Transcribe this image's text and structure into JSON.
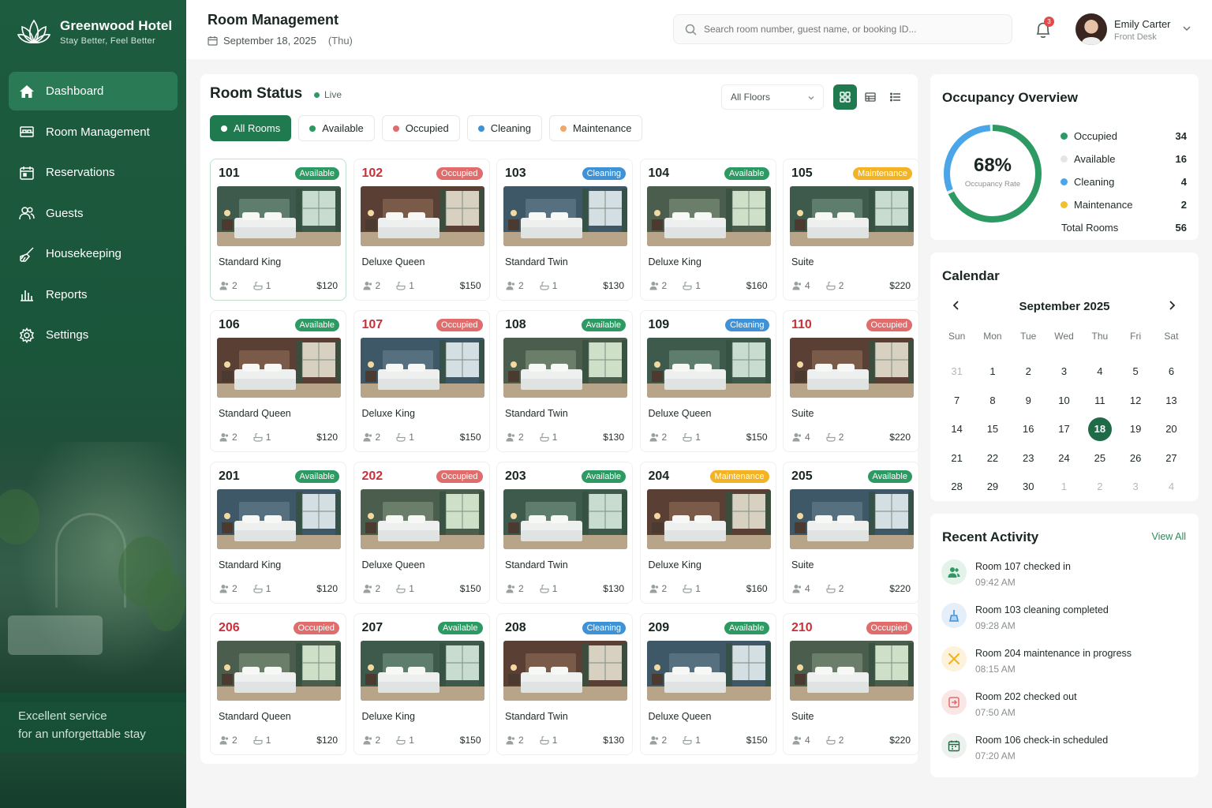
{
  "brand": {
    "name": "Greenwood Hotel",
    "tagline": "Stay Better, Feel Better"
  },
  "sidebar": {
    "items": [
      {
        "label": "Dashboard",
        "icon": "home-icon",
        "active": true
      },
      {
        "label": "Room Management",
        "icon": "bed-icon"
      },
      {
        "label": "Reservations",
        "icon": "calendar-icon"
      },
      {
        "label": "Guests",
        "icon": "users-icon"
      },
      {
        "label": "Housekeeping",
        "icon": "broom-icon"
      },
      {
        "label": "Reports",
        "icon": "bar-chart-icon"
      },
      {
        "label": "Settings",
        "icon": "gear-icon"
      }
    ],
    "footer_line1": "Excellent service",
    "footer_line2": "for an unforgettable stay"
  },
  "header": {
    "title": "Room Management",
    "date": "September 18, 2025",
    "weekday": "(Thu)",
    "search_placeholder": "Search room number, guest name, or booking ID...",
    "notification_count": "3",
    "user_name": "Emily Carter",
    "user_role": "Front Desk"
  },
  "room_status": {
    "title": "Room Status",
    "live_label": "Live",
    "floor_select": "All Floors",
    "filters": [
      {
        "label": "All Rooms",
        "active": true,
        "color": ""
      },
      {
        "label": "Available",
        "color": "#2e9a63"
      },
      {
        "label": "Occupied",
        "color": "#e06c6c"
      },
      {
        "label": "Cleaning",
        "color": "#3f92d6"
      },
      {
        "label": "Maintenance",
        "color": "#f0a86a"
      }
    ],
    "rooms": [
      {
        "number": "101",
        "status": "Available",
        "type": "Standard King",
        "guests": "2",
        "baths": "1",
        "price": "$120"
      },
      {
        "number": "102",
        "status": "Occupied",
        "type": "Deluxe Queen",
        "guests": "2",
        "baths": "1",
        "price": "$150"
      },
      {
        "number": "103",
        "status": "Cleaning",
        "type": "Standard Twin",
        "guests": "2",
        "baths": "1",
        "price": "$130"
      },
      {
        "number": "104",
        "status": "Available",
        "type": "Deluxe King",
        "guests": "2",
        "baths": "1",
        "price": "$160"
      },
      {
        "number": "105",
        "status": "Maintenance",
        "type": "Suite",
        "guests": "4",
        "baths": "2",
        "price": "$220"
      },
      {
        "number": "106",
        "status": "Available",
        "type": "Standard Queen",
        "guests": "2",
        "baths": "1",
        "price": "$120"
      },
      {
        "number": "107",
        "status": "Occupied",
        "type": "Deluxe King",
        "guests": "2",
        "baths": "1",
        "price": "$150"
      },
      {
        "number": "108",
        "status": "Available",
        "type": "Standard Twin",
        "guests": "2",
        "baths": "1",
        "price": "$130"
      },
      {
        "number": "109",
        "status": "Cleaning",
        "type": "Deluxe Queen",
        "guests": "2",
        "baths": "1",
        "price": "$150"
      },
      {
        "number": "110",
        "status": "Occupied",
        "type": "Suite",
        "guests": "4",
        "baths": "2",
        "price": "$220"
      },
      {
        "number": "201",
        "status": "Available",
        "type": "Standard King",
        "guests": "2",
        "baths": "1",
        "price": "$120"
      },
      {
        "number": "202",
        "status": "Occupied",
        "type": "Deluxe Queen",
        "guests": "2",
        "baths": "1",
        "price": "$150"
      },
      {
        "number": "203",
        "status": "Available",
        "type": "Standard Twin",
        "guests": "2",
        "baths": "1",
        "price": "$130"
      },
      {
        "number": "204",
        "status": "Maintenance",
        "type": "Deluxe King",
        "guests": "2",
        "baths": "1",
        "price": "$160"
      },
      {
        "number": "205",
        "status": "Available",
        "type": "Suite",
        "guests": "4",
        "baths": "2",
        "price": "$220"
      },
      {
        "number": "206",
        "status": "Occupied",
        "type": "Standard Queen",
        "guests": "2",
        "baths": "1",
        "price": "$120"
      },
      {
        "number": "207",
        "status": "Available",
        "type": "Deluxe King",
        "guests": "2",
        "baths": "1",
        "price": "$150"
      },
      {
        "number": "208",
        "status": "Cleaning",
        "type": "Standard Twin",
        "guests": "2",
        "baths": "1",
        "price": "$130"
      },
      {
        "number": "209",
        "status": "Available",
        "type": "Deluxe Queen",
        "guests": "2",
        "baths": "1",
        "price": "$150"
      },
      {
        "number": "210",
        "status": "Occupied",
        "type": "Suite",
        "guests": "4",
        "baths": "2",
        "price": "$220"
      }
    ]
  },
  "occupancy": {
    "title": "Occupancy Overview",
    "rate": "68%",
    "rate_label": "Occupancy Rate",
    "rate_fraction": 0.68,
    "legend": [
      {
        "label": "Occupied",
        "value": "34",
        "color": "#2e9a63"
      },
      {
        "label": "Available",
        "value": "16",
        "color": "#e4e6e4"
      },
      {
        "label": "Cleaning",
        "value": "4",
        "color": "#4aa6e8"
      },
      {
        "label": "Maintenance",
        "value": "2",
        "color": "#f2c02e"
      }
    ],
    "total_label": "Total Rooms",
    "total_value": "56"
  },
  "calendar": {
    "title": "Calendar",
    "month": "September 2025",
    "weekdays": [
      "Sun",
      "Mon",
      "Tue",
      "Wed",
      "Thu",
      "Fri",
      "Sat"
    ],
    "days": [
      {
        "d": "31",
        "muted": true
      },
      {
        "d": "1"
      },
      {
        "d": "2"
      },
      {
        "d": "3"
      },
      {
        "d": "4"
      },
      {
        "d": "5"
      },
      {
        "d": "6"
      },
      {
        "d": "7"
      },
      {
        "d": "8"
      },
      {
        "d": "9"
      },
      {
        "d": "10"
      },
      {
        "d": "11"
      },
      {
        "d": "12"
      },
      {
        "d": "13"
      },
      {
        "d": "14"
      },
      {
        "d": "15"
      },
      {
        "d": "16"
      },
      {
        "d": "17"
      },
      {
        "d": "18",
        "today": true
      },
      {
        "d": "19"
      },
      {
        "d": "20"
      },
      {
        "d": "21"
      },
      {
        "d": "22"
      },
      {
        "d": "23"
      },
      {
        "d": "24"
      },
      {
        "d": "25"
      },
      {
        "d": "26"
      },
      {
        "d": "27"
      },
      {
        "d": "28"
      },
      {
        "d": "29"
      },
      {
        "d": "30"
      },
      {
        "d": "1",
        "muted": true
      },
      {
        "d": "2",
        "muted": true
      },
      {
        "d": "3",
        "muted": true
      },
      {
        "d": "4",
        "muted": true
      }
    ]
  },
  "activity": {
    "title": "Recent Activity",
    "view_all": "View All",
    "items": [
      {
        "text": "Room 107 checked in",
        "time": "09:42 AM",
        "icon": "users-icon",
        "color": "#2e9a63",
        "bg": "#e3f3ea"
      },
      {
        "text": "Room 103 cleaning completed",
        "time": "09:28 AM",
        "icon": "broom-icon",
        "color": "#3f92d6",
        "bg": "#e4effa"
      },
      {
        "text": "Room 204 maintenance in progress",
        "time": "08:15 AM",
        "icon": "tools-icon",
        "color": "#f2b324",
        "bg": "#fdf3dc"
      },
      {
        "text": "Room 202 checked out",
        "time": "07:50 AM",
        "icon": "checkout-icon",
        "color": "#e06c6c",
        "bg": "#fbe6e6"
      },
      {
        "text": "Room 106 check-in scheduled",
        "time": "07:20 AM",
        "icon": "calendar-icon",
        "color": "#1f6b47",
        "bg": "#eef2ef"
      }
    ]
  }
}
